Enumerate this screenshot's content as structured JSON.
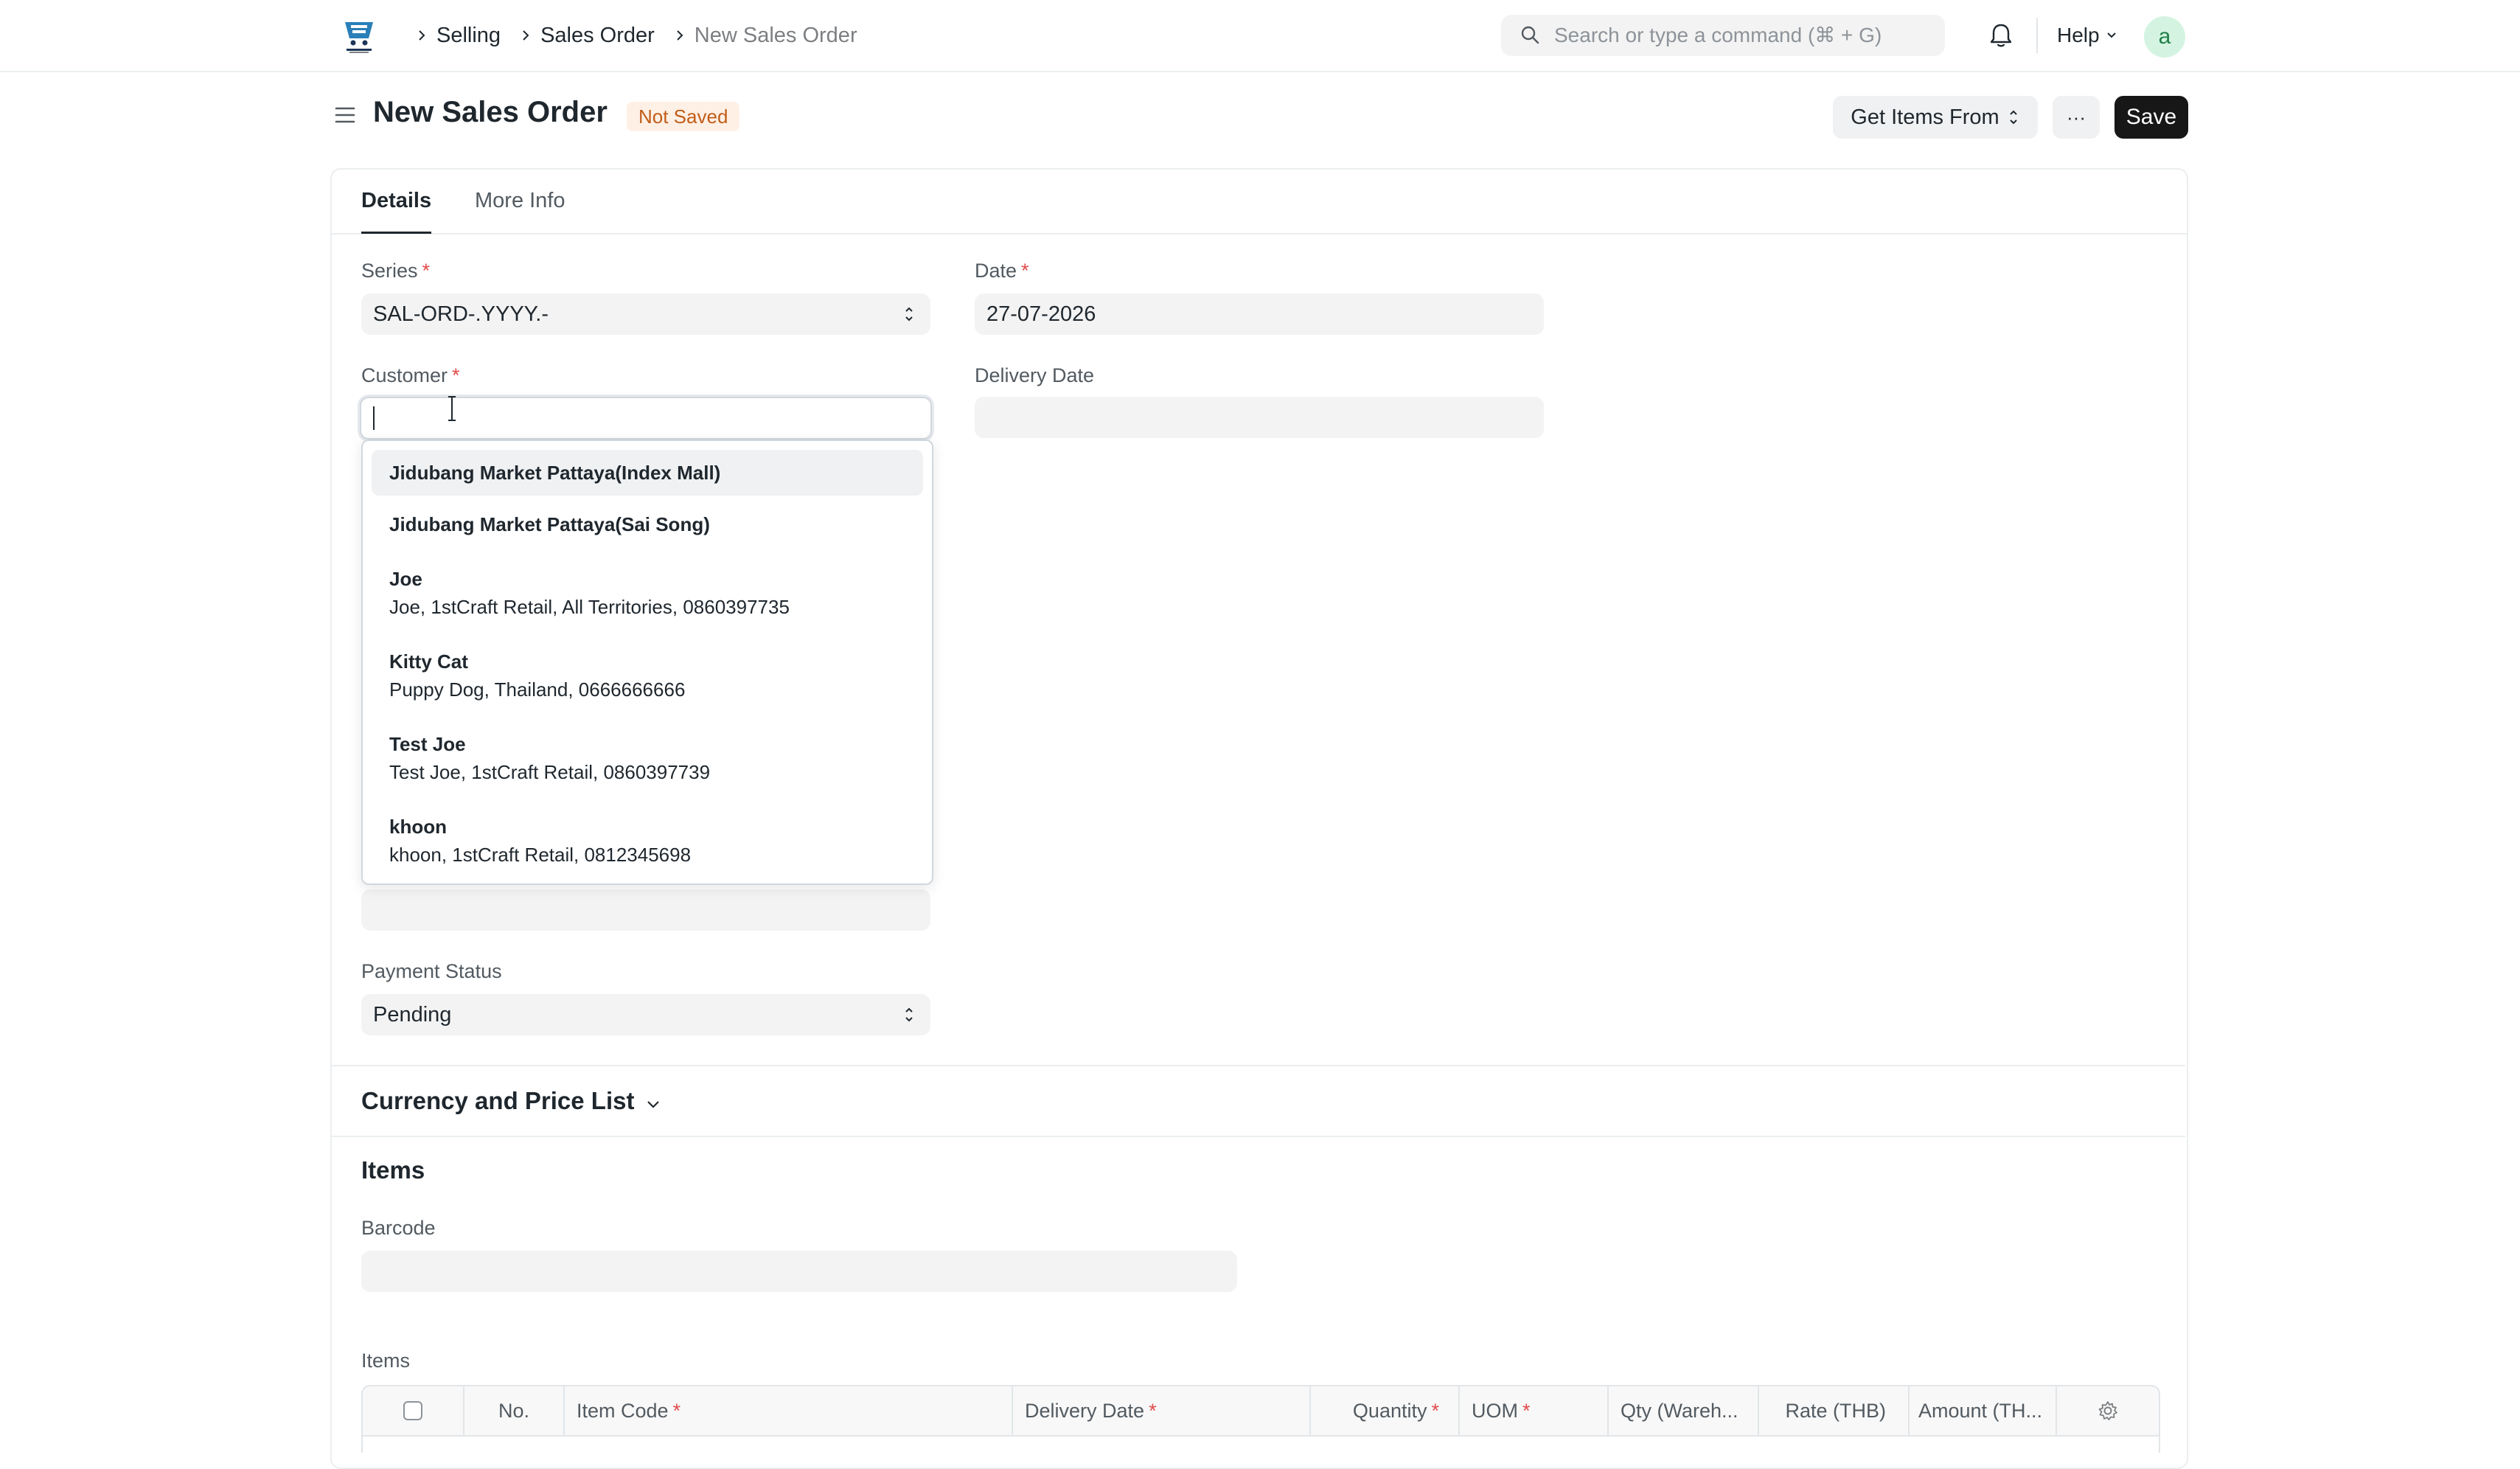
{
  "navbar": {
    "breadcrumbs": [
      "Selling",
      "Sales Order",
      "New Sales Order"
    ],
    "search_placeholder": "Search or type a command (⌘ + G)",
    "help_label": "Help",
    "avatar_letter": "a"
  },
  "page": {
    "title": "New Sales Order",
    "status": "Not Saved",
    "get_items_label": "Get Items From",
    "more_label": "···",
    "save_label": "Save"
  },
  "tabs": [
    "Details",
    "More Info"
  ],
  "form": {
    "series_label": "Series",
    "series_value": "SAL-ORD-.YYYY.-",
    "date_label": "Date",
    "date_value": "27-07-2026",
    "customer_label": "Customer",
    "customer_value": "",
    "delivery_date_label": "Delivery Date",
    "delivery_date_value": "",
    "payment_status_label": "Payment Status",
    "payment_status_value": "Pending",
    "required_mark": "*"
  },
  "customer_dropdown": [
    {
      "title": "Jidubang Market Pattaya(Index Mall)",
      "desc": "",
      "highlighted": true
    },
    {
      "title": "Jidubang Market Pattaya(Sai Song)",
      "desc": "",
      "highlighted": false
    },
    {
      "title": "Joe",
      "desc": "Joe, 1stCraft Retail, All Territories, 0860397735",
      "highlighted": false
    },
    {
      "title": "Kitty Cat",
      "desc": "Puppy Dog, Thailand, 0666666666",
      "highlighted": false
    },
    {
      "title": "Test Joe",
      "desc": "Test Joe, 1stCraft Retail, 0860397739",
      "highlighted": false
    },
    {
      "title": "khoon",
      "desc": "khoon, 1stCraft Retail, 0812345698",
      "highlighted": false
    }
  ],
  "sections": {
    "currency": "Currency and Price List",
    "items": "Items",
    "barcode_label": "Barcode",
    "items_table_label": "Items"
  },
  "items_table": {
    "columns": [
      "No.",
      "Item Code",
      "Delivery Date",
      "Quantity",
      "UOM",
      "Qty (Wareh...",
      "Rate (THB)",
      "Amount (TH..."
    ],
    "required_columns": [
      "Item Code",
      "Delivery Date",
      "Quantity",
      "UOM"
    ]
  },
  "colors": {
    "primary_button": "#171717",
    "indicator_bg": "#fff0e6",
    "indicator_text": "#c05d18",
    "required": "#e24c4c",
    "avatar_bg": "#d4f4e1",
    "avatar_text": "#228149"
  },
  "icons": {
    "logo": "app-logo-icon",
    "search": "search-icon",
    "notifications": "bell-icon",
    "sidebar_toggle": "hamburger-icon",
    "settings": "gear-icon"
  }
}
